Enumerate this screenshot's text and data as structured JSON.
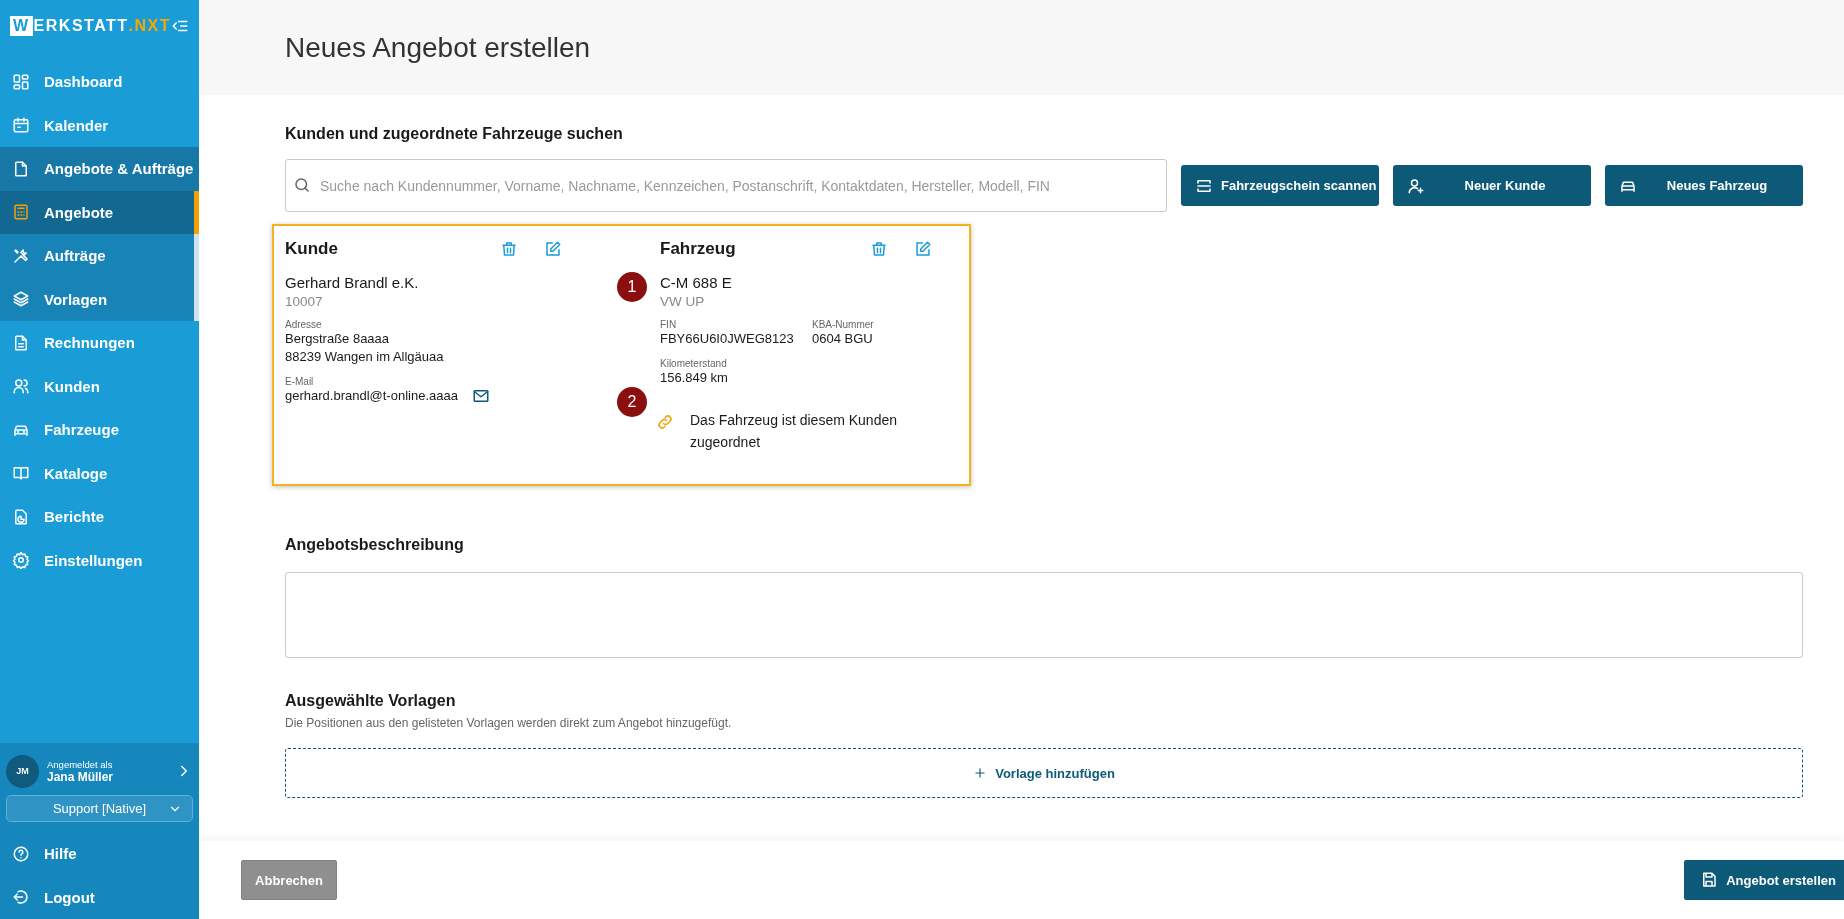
{
  "sidebar": {
    "logo": {
      "mark": "W",
      "text": "ERKSTATT",
      "suffix": ".NXT"
    },
    "items": [
      {
        "label": "Dashboard",
        "selected": false
      },
      {
        "label": "Kalender",
        "selected": false
      },
      {
        "label": "Angebote & Aufträge",
        "selected": false,
        "expanded": true,
        "children": [
          {
            "label": "Angebote",
            "selected": true
          },
          {
            "label": "Aufträge",
            "selected": false
          },
          {
            "label": "Vorlagen",
            "selected": false
          }
        ]
      },
      {
        "label": "Rechnungen",
        "selected": false
      },
      {
        "label": "Kunden",
        "selected": false
      },
      {
        "label": "Fahrzeuge",
        "selected": false
      },
      {
        "label": "Kataloge",
        "selected": false
      },
      {
        "label": "Berichte",
        "selected": false
      },
      {
        "label": "Einstellungen",
        "selected": false
      }
    ],
    "user": {
      "initials": "JM",
      "caption": "Angemeldet als",
      "name": "Jana Müller"
    },
    "role_select": {
      "value": "Support [Native]"
    },
    "bottom_items": [
      {
        "label": "Hilfe"
      },
      {
        "label": "Logout"
      }
    ]
  },
  "page_title": "Neues Angebot erstellen",
  "search_section": {
    "title": "Kunden und zugeordnete Fahrzeuge suchen",
    "search": {
      "placeholder": "Suche nach Kundennummer, Vorname, Nachname, Kennzeichen, Postanschrift, Kontaktdaten, Hersteller, Modell, FIN"
    },
    "buttons": [
      {
        "label": "Fahrzeugschein scannen"
      },
      {
        "label": "Neuer Kunde"
      },
      {
        "label": "Neues Fahrzeug"
      }
    ]
  },
  "customer": {
    "title": "Kunde",
    "name": "Gerhard Brandl e.K.",
    "number": "10007",
    "address_label": "Adresse",
    "address_lines": [
      "Bergstraße 8aaaa",
      "88239 Wangen im Allgäuaa"
    ],
    "email_label": "E-Mail",
    "email": "gerhard.brandl@t-online.aaaa"
  },
  "vehicle": {
    "title": "Fahrzeug",
    "plate": "C-M 688 E",
    "model": "VW UP",
    "fields": [
      {
        "label": "FIN",
        "value": "FBY66U6I0JWEG8123"
      },
      {
        "label": "KBA-Nummer",
        "value": "0604 BGU"
      },
      {
        "label": "Kilometerstand",
        "value": "156.849 km"
      }
    ],
    "link_note": "Das Fahrzeug ist diesem Kunden zugeordnet"
  },
  "markers": [
    "1",
    "2"
  ],
  "description": {
    "title": "Angebotsbeschreibung"
  },
  "templates": {
    "title": "Ausgewählte Vorlagen",
    "subtitle": "Die Positionen aus den gelisteten Vorlagen werden direkt zum Angebot hinzugefügt.",
    "add_label": "Vorlage hinzufügen"
  },
  "footer": {
    "cancel": "Abbrechen",
    "submit": "Angebot erstellen"
  }
}
